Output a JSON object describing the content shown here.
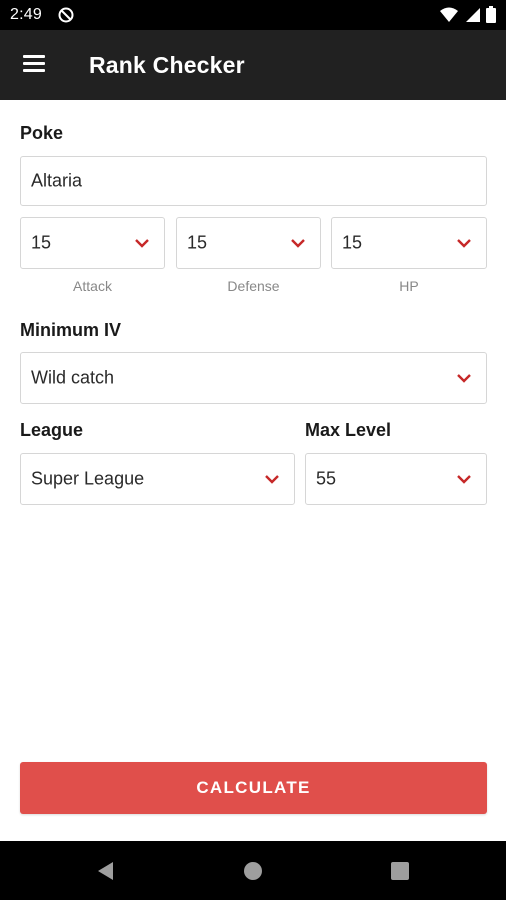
{
  "status": {
    "time": "2:49"
  },
  "app": {
    "title": "Rank Checker"
  },
  "form": {
    "poke_label": "Poke",
    "poke_value": "Altaria",
    "stats": [
      {
        "value": "15",
        "label": "Attack"
      },
      {
        "value": "15",
        "label": "Defense"
      },
      {
        "value": "15",
        "label": "HP"
      }
    ],
    "min_iv_label": "Minimum IV",
    "min_iv_value": "Wild catch",
    "league_label": "League",
    "league_value": "Super League",
    "max_level_label": "Max Level",
    "max_level_value": "55",
    "calculate_label": "CALCULATE"
  },
  "colors": {
    "accent": "#e04f4b",
    "app_bar": "#212121",
    "chevron": "#c62828"
  }
}
